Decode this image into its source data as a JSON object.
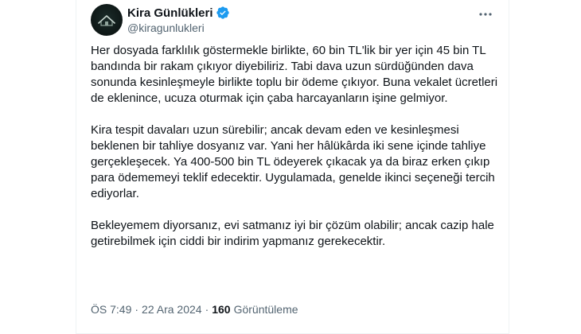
{
  "author": {
    "name": "Kira Günlükleri",
    "handle": "@kiragunlukleri"
  },
  "tweet": {
    "paragraphs": [
      "Her dosyada farklılık göstermekle birlikte, 60 bin TL'lik bir yer için 45 bin TL bandında bir rakam çıkıyor diyebiliriz. Tabi dava uzun sürdüğünden dava sonunda kesinleşmeyle birlikte toplu bir ödeme çıkıyor. Buna vekalet ücretleri de eklenince, ucuza oturmak için çaba harcayanların işine gelmiyor.",
      "Kira tespit davaları uzun sürebilir; ancak devam eden ve kesinleşmesi beklenen bir tahliye dosyanız var. Yani her hâlükârda iki sene içinde tahliye gerçekleşecek. Ya 400-500 bin TL ödeyerek çıkacak ya da biraz erken çıkıp para ödememeyi teklif edecektir. Uygulamada, genelde ikinci seçeneği tercih ediyorlar.",
      "Bekleyemem diyorsanız, evi satmanız iyi bir çözüm olabilir; ancak cazip hale getirebilmek için ciddi bir indirim yapmanız gerekecektir."
    ]
  },
  "meta": {
    "time": "ÖS 7:49",
    "separator": "·",
    "date": "22 Ara 2024",
    "views_count": "160",
    "views_label": "Görüntüleme"
  },
  "colors": {
    "text": "#0f1419",
    "secondary": "#536471",
    "verified": "#1d9bf0"
  },
  "icons": {
    "verified": "verified-badge-icon",
    "more": "more-options-icon",
    "avatar": "house-logo"
  }
}
